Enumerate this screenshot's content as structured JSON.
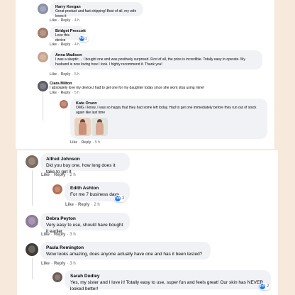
{
  "colors": {
    "page_bg": "#f7e9dc",
    "bubble_bg": "#f0f2f5",
    "like_blue": "#1877f2",
    "meta_gray": "#65676b"
  },
  "actions": {
    "like": "Like",
    "reply": "Reply"
  },
  "top_thread": [
    {
      "id": "harry",
      "author": "Harry Keegan",
      "text": "Great product and fast shipping! Best of all, my wife loves it",
      "time": "4 h",
      "avatar_icon": "user-avatar-icon"
    },
    {
      "id": "bridget",
      "author": "Bridget Prescott",
      "text": "Love this device",
      "time": "4 h",
      "reactions": "1",
      "avatar_icon": "user-avatar-icon"
    },
    {
      "id": "anna",
      "author": "Anna Madison",
      "text": "I was a skeptic ... I bought one and was positively surprised. First of all, the price is incredible. Totally easy to operate. My husband is now loving how I look. I highly recommend it. Thank you!",
      "time": "5 h",
      "avatar_icon": "user-avatar-icon"
    },
    {
      "id": "ciara",
      "author": "Ciara Milton",
      "text": "I absolutely love my device,I had to get one for my daughter today since she wont stop using mine!",
      "time": "5 h",
      "avatar_icon": "user-avatar-icon"
    },
    {
      "id": "kate",
      "author": "Kate Orson",
      "text": "OMG I know, I was so happy that they had some left today. Had to get one immediately before they run out of stock again like last time",
      "time": "5 h",
      "avatar_icon": "user-avatar-icon",
      "photos": [
        "photo-icon",
        "photo-icon"
      ]
    }
  ],
  "bottom_thread": [
    {
      "id": "alfred",
      "author": "Alfred Johnson",
      "text": "Did you buy one, how long does it take to get it",
      "time": "2 h"
    },
    {
      "id": "edith",
      "author": "Edith Ashton",
      "text": "For me 7 business days.",
      "time": "2 h",
      "reactions": "3"
    },
    {
      "id": "debra",
      "author": "Debra Peyton",
      "text": "Very easy to use, should have bought it earlier",
      "time": "3 h"
    },
    {
      "id": "paula",
      "author": "Paula Remington",
      "text": "Wow looks amazing, does anyone actually have one and has it been tested?",
      "time": "3 h"
    },
    {
      "id": "sarah",
      "author": "Sarah Dudley",
      "text": "Yes, my sister and I love it! Totally easy to use, super fun and feels great! Our skin has NEVER looked better!",
      "time": "3 h",
      "reactions": "2"
    }
  ]
}
